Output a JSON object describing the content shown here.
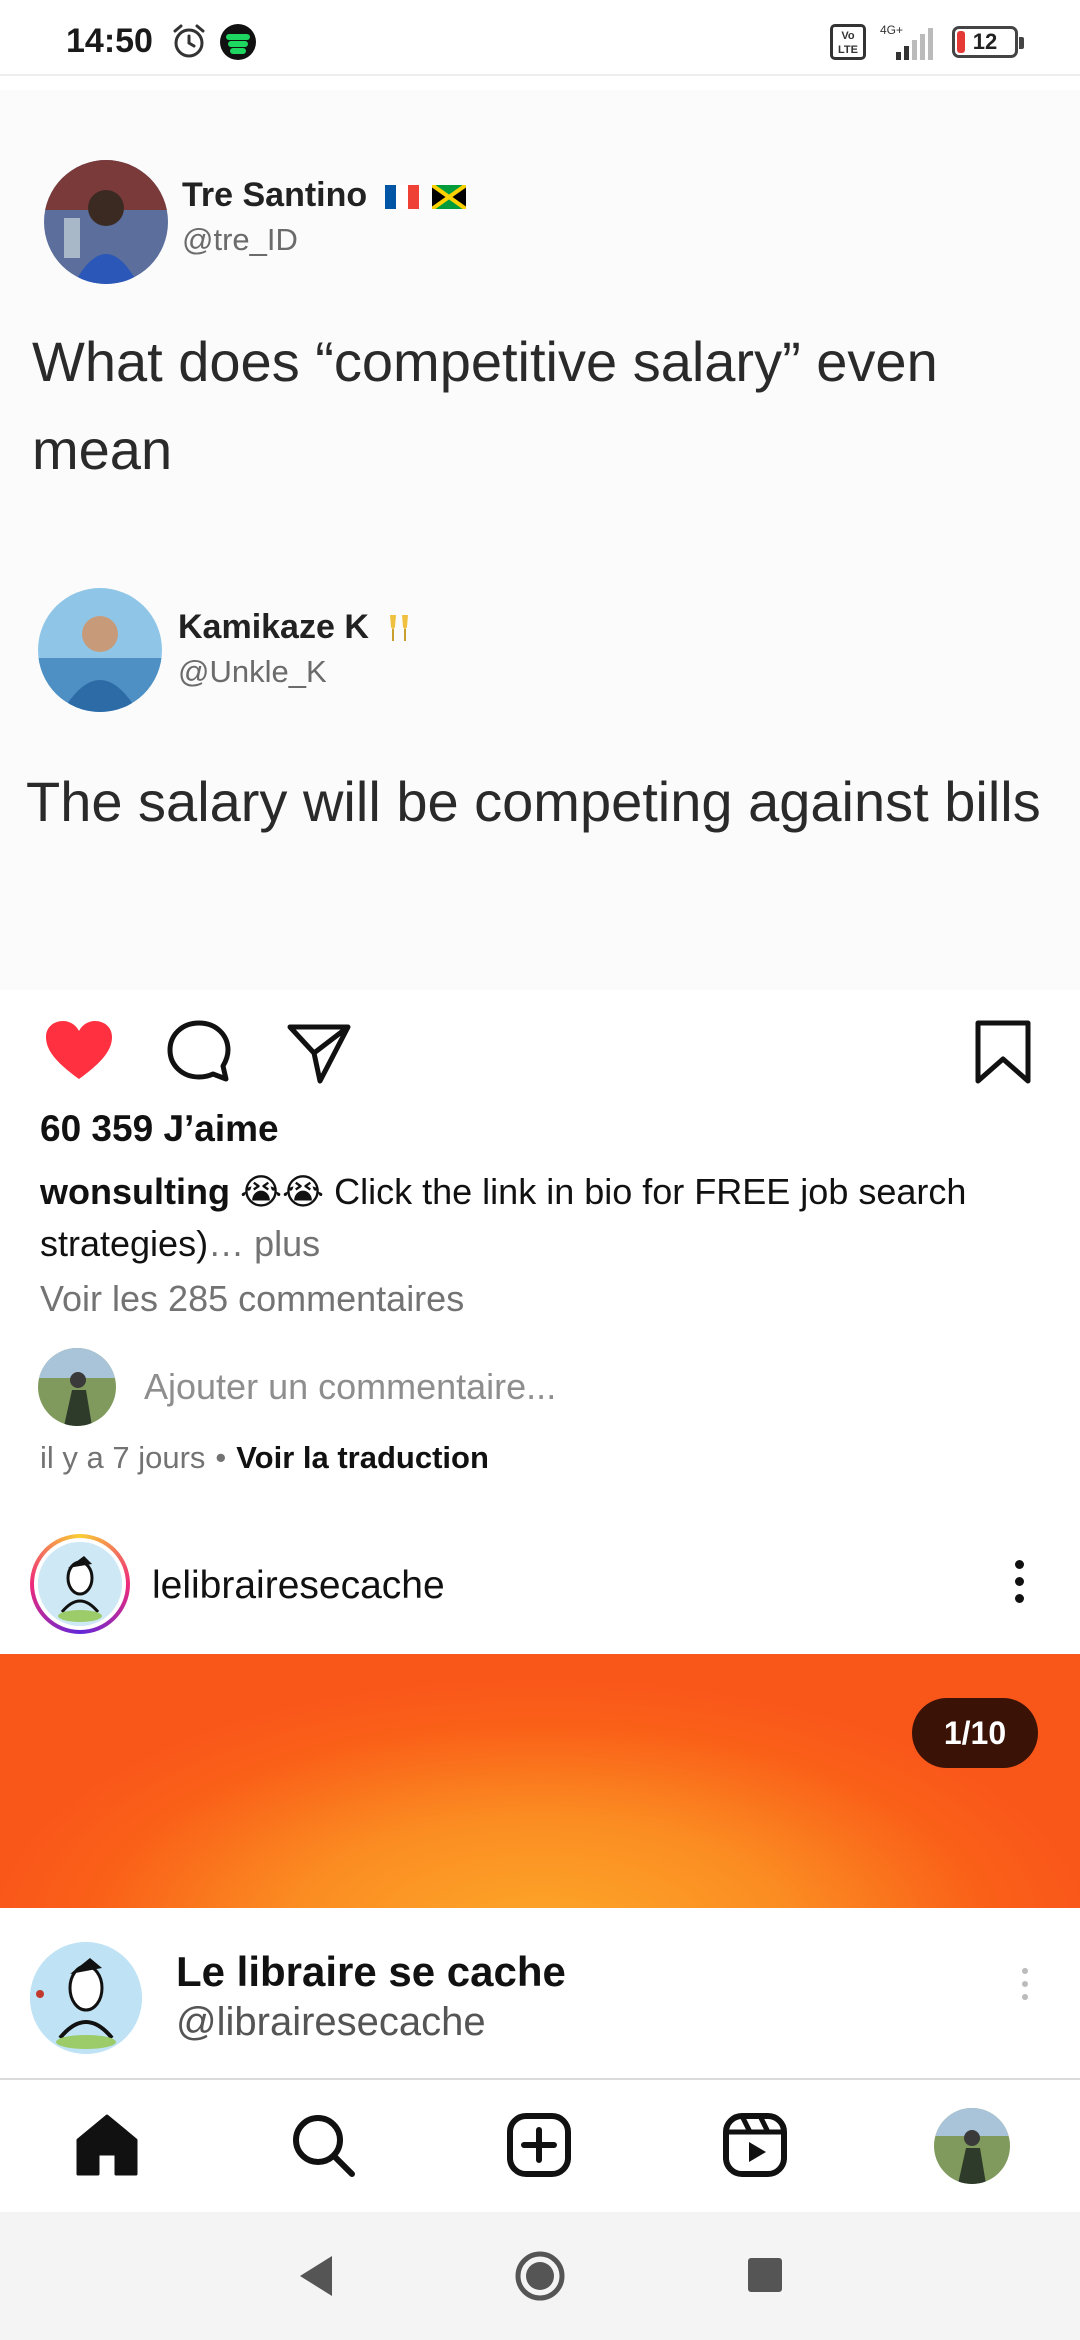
{
  "status_bar": {
    "time": "14:50",
    "network": "4G+",
    "volte": "Vo LTE",
    "battery": "12",
    "icons": [
      "alarm-icon",
      "spotify-icon",
      "signal-icon",
      "battery-icon"
    ]
  },
  "post": {
    "tweet_image": {
      "tweet1": {
        "name": "Tre Santino",
        "handle": "@tre_ID",
        "text": "What does “competitive salary” even mean"
      },
      "tweet2": {
        "name": "Kamikaze K",
        "handle": "@Unkle_K",
        "text": "The salary will be competing against bills"
      }
    },
    "actions": {
      "like_icon": "heart-filled-icon",
      "comment_icon": "comment-icon",
      "share_icon": "send-icon",
      "save_icon": "bookmark-icon"
    },
    "likes": "60 359 J’aime",
    "caption": {
      "username": "wonsulting",
      "emojis": "😭😭",
      "text": "Click the link in bio for FREE job search strategies)",
      "more": "… plus"
    },
    "view_comments": "Voir les 285 commentaires",
    "add_comment_placeholder": "Ajouter un commentaire...",
    "time_ago": "il y a 7 jours",
    "separator": "•",
    "translate": "Voir la traduction"
  },
  "next_post": {
    "username": "lelibrairesecache",
    "counter": "1/10",
    "embed_name": "Le libraire se cache",
    "embed_handle": "@librairesecache"
  },
  "colors": {
    "like_red": "#ff3040",
    "story_ring": "#ee2a7b",
    "media_orange": "#fa6018",
    "muted_text": "#737373"
  },
  "bottom_nav": {
    "items": [
      "home-icon",
      "search-icon",
      "create-icon",
      "reels-icon",
      "profile-avatar"
    ]
  },
  "system_nav": {
    "items": [
      "back-icon",
      "home-circle-icon",
      "recents-icon"
    ]
  }
}
